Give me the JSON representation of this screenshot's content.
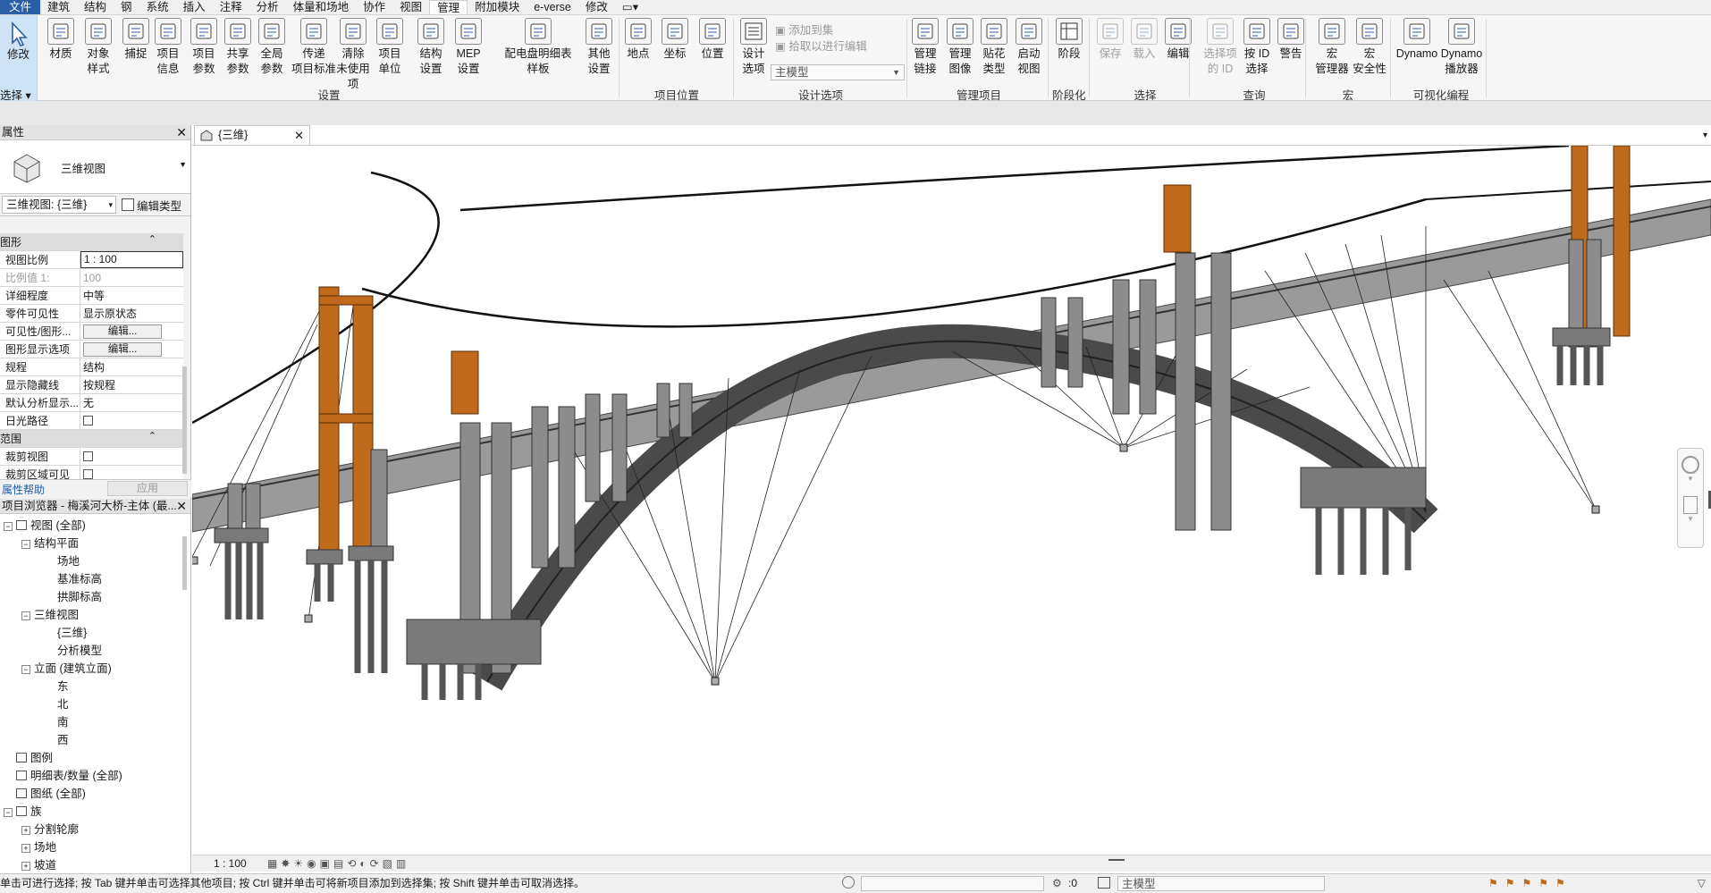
{
  "menu": {
    "tabs": [
      "文件",
      "建筑",
      "结构",
      "钢",
      "系统",
      "插入",
      "注释",
      "分析",
      "体量和场地",
      "协作",
      "视图",
      "管理",
      "附加模块",
      "e-verse",
      "修改"
    ],
    "active_tab": "管理"
  },
  "ribbon": {
    "modify_label": "修改",
    "select_label": "选择",
    "settings_buttons": [
      {
        "l1": "材质",
        "l2": "",
        "icon": "materials-icon"
      },
      {
        "l1": "对象",
        "l2": "样式",
        "icon": "object-styles-icon"
      },
      {
        "l1": "捕捉",
        "l2": "",
        "icon": "snap-icon"
      },
      {
        "l1": "项目",
        "l2": "信息",
        "icon": "project-info-icon"
      },
      {
        "l1": "项目",
        "l2": "参数",
        "icon": "project-parameters-icon"
      },
      {
        "l1": "共享",
        "l2": "参数",
        "icon": "shared-parameters-icon"
      },
      {
        "l1": "全局",
        "l2": "参数",
        "icon": "global-parameters-icon"
      },
      {
        "l1": "传递",
        "l2": "项目标准",
        "icon": "transfer-standards-icon"
      },
      {
        "l1": "清除",
        "l2": "未使用项",
        "icon": "purge-icon"
      },
      {
        "l1": "项目",
        "l2": "单位",
        "icon": "project-units-icon"
      },
      {
        "l1": "结构",
        "l2": "设置",
        "icon": "structural-settings-icon"
      },
      {
        "l1": "MEP",
        "l2": "设置",
        "icon": "mep-settings-icon"
      },
      {
        "l1": "配电盘明细表",
        "l2": "样板",
        "icon": "panel-schedule-icon"
      },
      {
        "l1": "其他",
        "l2": "设置",
        "icon": "wrench-icon"
      }
    ],
    "location_buttons": [
      {
        "l1": "地点",
        "l2": "",
        "icon": "globe-icon"
      },
      {
        "l1": "坐标",
        "l2": "",
        "icon": "coordinates-icon"
      },
      {
        "l1": "位置",
        "l2": "",
        "icon": "position-icon"
      }
    ],
    "design_option_button": {
      "l1": "设计",
      "l2": "选项"
    },
    "add_to_set": "添加到集",
    "pick_to_edit": "拾取以进行编辑",
    "main_model": "主模型",
    "manage_buttons": [
      {
        "l1": "管理",
        "l2": "链接",
        "icon": "manage-links-icon"
      },
      {
        "l1": "管理",
        "l2": "图像",
        "icon": "manage-images-icon"
      },
      {
        "l1": "贴花",
        "l2": "类型",
        "icon": "decal-types-icon"
      },
      {
        "l1": "启动",
        "l2": "视图",
        "icon": "starting-view-icon"
      }
    ],
    "phase_button": {
      "l1": "阶段",
      "l2": ""
    },
    "selection_buttons": [
      {
        "l1": "保存",
        "l2": "",
        "disabled": true
      },
      {
        "l1": "载入",
        "l2": "",
        "disabled": true
      },
      {
        "l1": "编辑",
        "l2": "",
        "disabled": false
      }
    ],
    "inquiry_buttons": [
      {
        "l1": "选择项",
        "l2": "的 ID",
        "disabled": true
      },
      {
        "l1": "按 ID",
        "l2": "选择",
        "disabled": false
      },
      {
        "l1": "警告",
        "l2": "",
        "disabled": false
      }
    ],
    "macro_buttons": [
      {
        "l1": "宏",
        "l2": "管理器"
      },
      {
        "l1": "宏",
        "l2": "安全性"
      }
    ],
    "dynamo_buttons": [
      {
        "l1": "Dynamo",
        "l2": ""
      },
      {
        "l1": "Dynamo",
        "l2": "播放器"
      }
    ],
    "groups": [
      "设置",
      "项目位置",
      "设计选项",
      "管理项目",
      "阶段化",
      "选择",
      "查询",
      "宏",
      "可视化编程"
    ]
  },
  "properties": {
    "title": "属性",
    "type_name": "三维视图",
    "instance_selector": "三维视图: {三维}",
    "edit_type": "编辑类型",
    "sections": {
      "graphics": "图形",
      "extents": "范围"
    },
    "rows": [
      {
        "k": "视图比例",
        "v": "1 : 100",
        "kind": "input"
      },
      {
        "k": "比例值 1:",
        "v": "100",
        "kind": "grey"
      },
      {
        "k": "详细程度",
        "v": "中等",
        "kind": "text"
      },
      {
        "k": "零件可见性",
        "v": "显示原状态",
        "kind": "text"
      },
      {
        "k": "可见性/图形...",
        "v": "编辑...",
        "kind": "button"
      },
      {
        "k": "图形显示选项",
        "v": "编辑...",
        "kind": "button"
      },
      {
        "k": "规程",
        "v": "结构",
        "kind": "text"
      },
      {
        "k": "显示隐藏线",
        "v": "按规程",
        "kind": "text"
      },
      {
        "k": "默认分析显示...",
        "v": "无",
        "kind": "text"
      },
      {
        "k": "日光路径",
        "v": "",
        "kind": "check"
      }
    ],
    "extent_rows": [
      {
        "k": "裁剪视图",
        "v": ""
      },
      {
        "k": "裁剪区域可见",
        "v": ""
      }
    ],
    "help_link": "属性帮助",
    "apply": "应用"
  },
  "browser": {
    "title": "项目浏览器 - 梅溪河大桥-主体 (最...",
    "items": [
      {
        "text": "视图 (全部)",
        "indent": 0,
        "expander": "−",
        "icon": "views-icon"
      },
      {
        "text": "结构平面",
        "indent": 1,
        "expander": "−",
        "icon": ""
      },
      {
        "text": "场地",
        "indent": 3,
        "expander": "",
        "icon": ""
      },
      {
        "text": "基准标高",
        "indent": 3,
        "expander": "",
        "icon": ""
      },
      {
        "text": "拱脚标高",
        "indent": 3,
        "expander": "",
        "icon": ""
      },
      {
        "text": "三维视图",
        "indent": 1,
        "expander": "−",
        "icon": ""
      },
      {
        "text": "{三维}",
        "indent": 3,
        "expander": "",
        "icon": ""
      },
      {
        "text": "分析模型",
        "indent": 3,
        "expander": "",
        "icon": ""
      },
      {
        "text": "立面 (建筑立面)",
        "indent": 1,
        "expander": "−",
        "icon": ""
      },
      {
        "text": "东",
        "indent": 3,
        "expander": "",
        "icon": ""
      },
      {
        "text": "北",
        "indent": 3,
        "expander": "",
        "icon": ""
      },
      {
        "text": "南",
        "indent": 3,
        "expander": "",
        "icon": ""
      },
      {
        "text": "西",
        "indent": 3,
        "expander": "",
        "icon": ""
      },
      {
        "text": "图例",
        "indent": 0,
        "expander": "",
        "icon": "legend-icon"
      },
      {
        "text": "明细表/数量 (全部)",
        "indent": 0,
        "expander": "",
        "icon": "schedule-icon"
      },
      {
        "text": "图纸 (全部)",
        "indent": 0,
        "expander": "",
        "icon": "sheets-icon"
      },
      {
        "text": "族",
        "indent": 0,
        "expander": "−",
        "icon": "families-icon"
      },
      {
        "text": "分割轮廓",
        "indent": 1,
        "expander": "+",
        "icon": ""
      },
      {
        "text": "场地",
        "indent": 1,
        "expander": "+",
        "icon": ""
      },
      {
        "text": "坡道",
        "indent": 1,
        "expander": "+",
        "icon": ""
      }
    ]
  },
  "view": {
    "tab_title": "{三维}",
    "scale": "1 : 100"
  },
  "status": {
    "message": "单击可进行选择; 按 Tab 键并单击可选择其他项目; 按 Ctrl 键并单击可将新项目添加到选择集; 按 Shift 键并单击可取消选择。",
    "workset_count": ":0",
    "model": "主模型"
  },
  "colors": {
    "accent": "#2a5ea8",
    "steel": "#c06a1c",
    "concrete": "#8c8c8c"
  }
}
